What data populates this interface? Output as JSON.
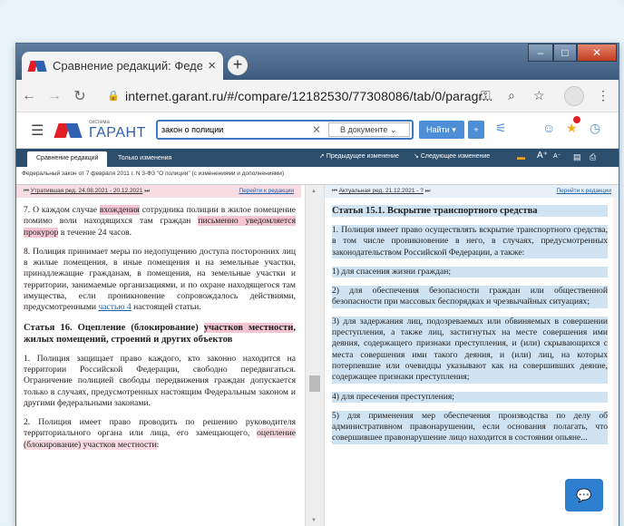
{
  "browser": {
    "tab_title": "Сравнение редакций: Федерал",
    "tab_close": "×",
    "new_tab": "+",
    "url": "internet.garant.ru/#/compare/12182530/77308086/tab/0/paragr...",
    "window_controls": {
      "minimize": "–",
      "maximize": "□",
      "close": "✕"
    }
  },
  "app": {
    "logo_system": "система",
    "logo_name": "ГАРАНТ",
    "search_value": "закон о полиции",
    "search_scope": "В документе",
    "find_button": "Найти",
    "accent_color": "#3c79c0",
    "brand_red": "#e11d25"
  },
  "toolbar": {
    "tab_compare": "Сравнение редакций",
    "tab_changes": "Только изменения",
    "prev_change": "Предыдущее изменение",
    "next_change": "Следующее изменение"
  },
  "document": {
    "title": "Федеральный закон от 7 февраля 2011 г. N 3-ФЗ \"О полиции\" (с изменениями и дополнениями)"
  },
  "left_pane": {
    "header_prefix": "⏮ ",
    "header_version": "Утратившая ред. 24.08.2021 - 20.12.2021",
    "header_suffix": " ⏭",
    "go_link": "Перейти к редакции",
    "p7_a": "7. О каждом случае ",
    "p7_hl1": "вхождения",
    "p7_b": " сотрудника полиции в жилое помещение помимо воли находящихся там граждан ",
    "p7_hl2": "письменно уведомляется прокурор",
    "p7_c": " в течение 24 часов.",
    "p8_a": "8. Полиция принимает меры по недопущению доступа посторонних лиц в жилые помещения, в иные помещения и на земельные участки, принадлежащие гражданам, в помещения, на земельные участки и территории, занимаемые организациями, и по охране находящегося там имущества, если проникновение сопровождалось действиями, предусмотренными ",
    "p8_link": "частью 4",
    "p8_b": " настоящей статьи.",
    "h16_a": "Статья 16. Оцепление (блокирование) ",
    "h16_hl": "участков местности",
    "h16_b": ", жилых помещений, строений и других объектов",
    "p1": "1. Полиция защищает право каждого, кто законно находится на территории Российской Федерации, свободно передвигаться. Ограничение полицией свободы передвижения граждан допускается только в случаях, предусмотренных настоящим Федеральным законом и другими федеральными законами.",
    "p2_a": "2. Полиция имеет право проводить по решению руководителя территориального органа или лица, его замещающего, ",
    "p2_hl": "оцепление (блокирование) участков местности",
    "p2_b": ":"
  },
  "right_pane": {
    "header_prefix": "⏮ ",
    "header_version": "Актуальная ред. 21.12.2021 - ?",
    "header_suffix": " ⏭",
    "go_link": "Перейти к редакции",
    "h151": "Статья 15.1. Вскрытие транспортного средства",
    "p1": "1. Полиция имеет право осуществлять вскрытие транспортного средства, в том числе проникновение в него, в случаях, предусмотренных законодательством Российской Федерации, а также:",
    "p_1": "1) для спасения жизни граждан;",
    "p_2": "2) для обеспечения безопасности граждан или общественной безопасности при массовых беспорядках и чрезвычайных ситуациях;",
    "p_3": "3) для задержания лиц, подозреваемых или обвиняемых в совершении преступления, а также лиц, застигнутых на месте совершения ими деяния, содержащего признаки преступления, и (или) скрывающихся с места совершения ими такого деяния, и (или) лиц, на которых потерпевшие или очевидцы указывают как на совершивших деяние, содержащее признаки преступления;",
    "p_4": "4) для пресечения преступления;",
    "p_5": "5) для применения мер обеспечения производства по делу об административном правонарушении, если основания полагать, что совершившее правонарушение лицо находится в состоянии опьяне..."
  }
}
